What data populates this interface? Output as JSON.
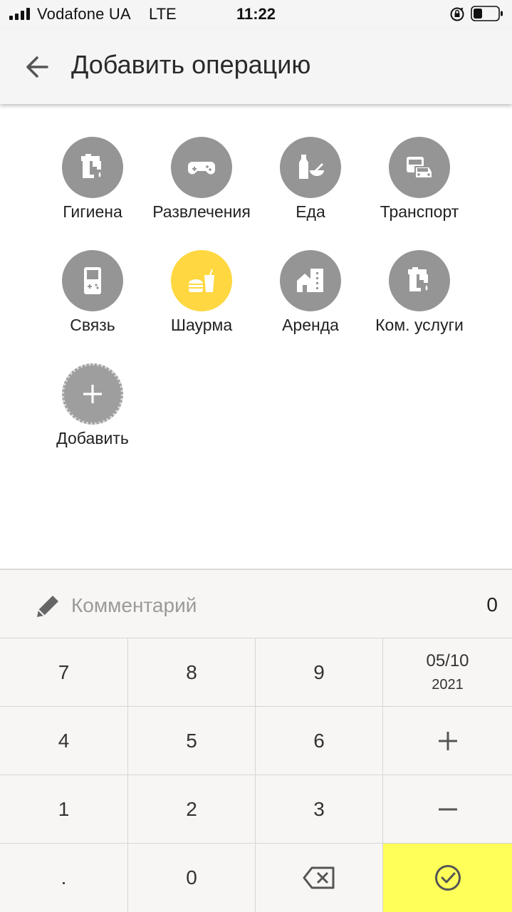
{
  "status_bar": {
    "carrier": "Vodafone UA",
    "network": "LTE",
    "time": "11:22"
  },
  "header": {
    "title": "Добавить операцию",
    "back_icon": "arrow-left-icon"
  },
  "categories": [
    {
      "label": "Гигиена",
      "icon": "faucet-icon",
      "selected": false
    },
    {
      "label": "Развлечения",
      "icon": "gamepad-icon",
      "selected": false
    },
    {
      "label": "Еда",
      "icon": "bottle-bowl-icon",
      "selected": false
    },
    {
      "label": "Транспорт",
      "icon": "bus-car-icon",
      "selected": false
    },
    {
      "label": "Связь",
      "icon": "handheld-phone-icon",
      "selected": false
    },
    {
      "label": "Шаурма",
      "icon": "fastfood-icon",
      "selected": true
    },
    {
      "label": "Аренда",
      "icon": "buildings-icon",
      "selected": false
    },
    {
      "label": "Ком. услуги",
      "icon": "faucet-icon",
      "selected": false
    }
  ],
  "add_category": {
    "label": "Добавить",
    "icon": "plus-icon"
  },
  "comment": {
    "placeholder": "Комментарий",
    "value": "",
    "icon": "pencil-icon"
  },
  "amount": "0",
  "keypad": {
    "keys": [
      "7",
      "8",
      "9",
      "4",
      "5",
      "6",
      "1",
      "2",
      "3",
      ".",
      "0"
    ],
    "date_day_month": "05/10",
    "date_year": "2021",
    "plus_icon": "plus-icon",
    "minus_icon": "minus-icon",
    "backspace_icon": "backspace-icon",
    "confirm_icon": "check-circle-icon"
  },
  "colors": {
    "selected_category": "#ffd740",
    "category": "#959595",
    "confirm_key": "#ffff59"
  }
}
